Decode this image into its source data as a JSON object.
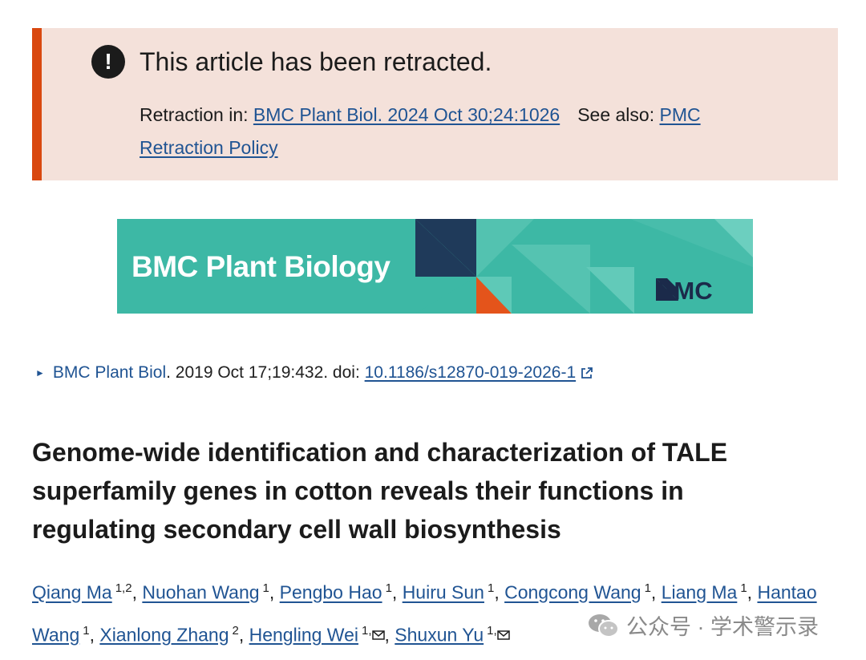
{
  "retraction": {
    "title": "This article has been retracted.",
    "retraction_label": "Retraction in: ",
    "retraction_link": "BMC Plant Biol. 2024 Oct 30;24:1026",
    "see_also_label": "See also: ",
    "policy_link": "PMC Retraction Policy"
  },
  "journal_banner": {
    "name": "BMC Plant Biology",
    "publisher": "BMC"
  },
  "citation": {
    "journal_link": "BMC Plant Biol",
    "details": ". 2019 Oct 17;19:432. doi: ",
    "doi": "10.1186/s12870-019-2026-1"
  },
  "article": {
    "title": "Genome-wide identification and characterization of TALE superfamily genes in cotton reveals their functions in regulating secondary cell wall biosynthesis"
  },
  "authors": [
    {
      "name": "Qiang Ma",
      "aff": "1,2",
      "mail": false
    },
    {
      "name": "Nuohan Wang",
      "aff": "1",
      "mail": false
    },
    {
      "name": "Pengbo Hao",
      "aff": "1",
      "mail": false
    },
    {
      "name": "Huiru Sun",
      "aff": "1",
      "mail": false
    },
    {
      "name": "Congcong Wang",
      "aff": "1",
      "mail": false
    },
    {
      "name": "Liang Ma",
      "aff": "1",
      "mail": false
    },
    {
      "name": "Hantao Wang",
      "aff": "1",
      "mail": false
    },
    {
      "name": "Xianlong Zhang",
      "aff": "2",
      "mail": false
    },
    {
      "name": "Hengling Wei",
      "aff": "1,",
      "mail": true
    },
    {
      "name": "Shuxun Yu",
      "aff": "1,",
      "mail": true
    }
  ],
  "watermark": {
    "text": "公众号 · 学术警示录"
  },
  "colors": {
    "link": "#205493",
    "retraction_bg": "#f4e1da",
    "retraction_bar": "#d9480f",
    "journal_bg": "#3db8a5"
  },
  "icons": {
    "alert": "exclamation-circle-icon",
    "external": "external-link-icon",
    "mail": "envelope-icon",
    "wechat": "wechat-icon"
  }
}
